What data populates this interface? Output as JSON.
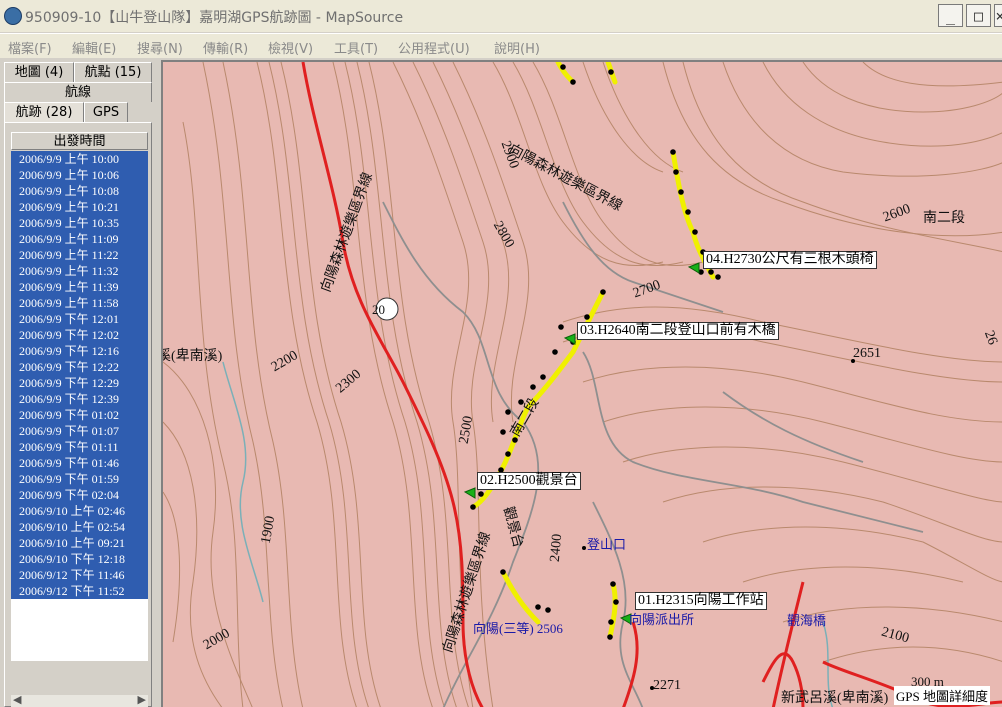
{
  "window": {
    "title": "950909-10【山牛登山隊】嘉明湖GPS航跡圖 - MapSource",
    "minimize": "_",
    "maximize": "□",
    "close": "×"
  },
  "menu": [
    "檔案(F)",
    "編輯(E)",
    "搜尋(N)",
    "傳輸(R)",
    "檢視(V)",
    "工具(T)",
    "公用程式(U)",
    "說明(H)"
  ],
  "tabs": {
    "maps": "地圖 (4)",
    "waypoints": "航點 (15)",
    "routes": "航線",
    "tracks": "航跡 (28)",
    "gps": "GPS"
  },
  "list": {
    "header": "出發時間",
    "rows": [
      "2006/9/9 上午 10:00",
      "2006/9/9 上午 10:06",
      "2006/9/9 上午 10:08",
      "2006/9/9 上午 10:21",
      "2006/9/9 上午 10:35",
      "2006/9/9 上午 11:09",
      "2006/9/9 上午 11:22",
      "2006/9/9 上午 11:32",
      "2006/9/9 上午 11:39",
      "2006/9/9 上午 11:58",
      "2006/9/9 下午 12:01",
      "2006/9/9 下午 12:02",
      "2006/9/9 下午 12:16",
      "2006/9/9 下午 12:22",
      "2006/9/9 下午 12:29",
      "2006/9/9 下午 12:39",
      "2006/9/9 下午 01:02",
      "2006/9/9 下午 01:07",
      "2006/9/9 下午 01:11",
      "2006/9/9 下午 01:46",
      "2006/9/9 下午 01:59",
      "2006/9/9 下午 02:04",
      "2006/9/10 上午 02:46",
      "2006/9/10 上午 02:54",
      "2006/9/10 上午 09:21",
      "2006/9/10 下午 12:18",
      "2006/9/12 下午 11:46",
      "2006/9/12 下午 11:52"
    ]
  },
  "map": {
    "waypoints": [
      "01.H2315向陽工作站",
      "02.H2500觀景台",
      "03.H2640南二段登山口前有木橋",
      "04.H2730公尺有三根木頭椅"
    ],
    "labels": {
      "boundary1": "向陽森林遊樂區界線",
      "boundary2": "向陽森林遊樂區界線",
      "boundary3": "向陽森林遊樂區界線",
      "route_nan2": "南二段",
      "route_nan2b": "南二段",
      "trail_view": "觀景台",
      "trailhead": "登山口",
      "police": "向陽派出所",
      "guanhai": "觀海橋",
      "xiangyang": "向陽(三等) 2506",
      "river_n": "溪(卑南溪)",
      "river_s": "新武呂溪(卑南溪)",
      "road": "20",
      "scale": "300 m"
    },
    "contours": {
      "c1900": "1900",
      "c2000": "2000",
      "c2100": "2100",
      "c2200": "2200",
      "c2300": "2300",
      "c2400": "2400",
      "c2500": "2500",
      "c2600": "2600",
      "c2700": "2700",
      "c2800": "2800",
      "c2900": "2900",
      "h2651": "2651",
      "h2271": "2271",
      "edge": "26"
    },
    "status": "GPS 地圖詳細度"
  },
  "colors": {
    "map_bg": "#e8b9b2",
    "contour": "#b9896d",
    "road": "#e02020",
    "track": "#f0f000",
    "selection": "#2f5db0"
  }
}
